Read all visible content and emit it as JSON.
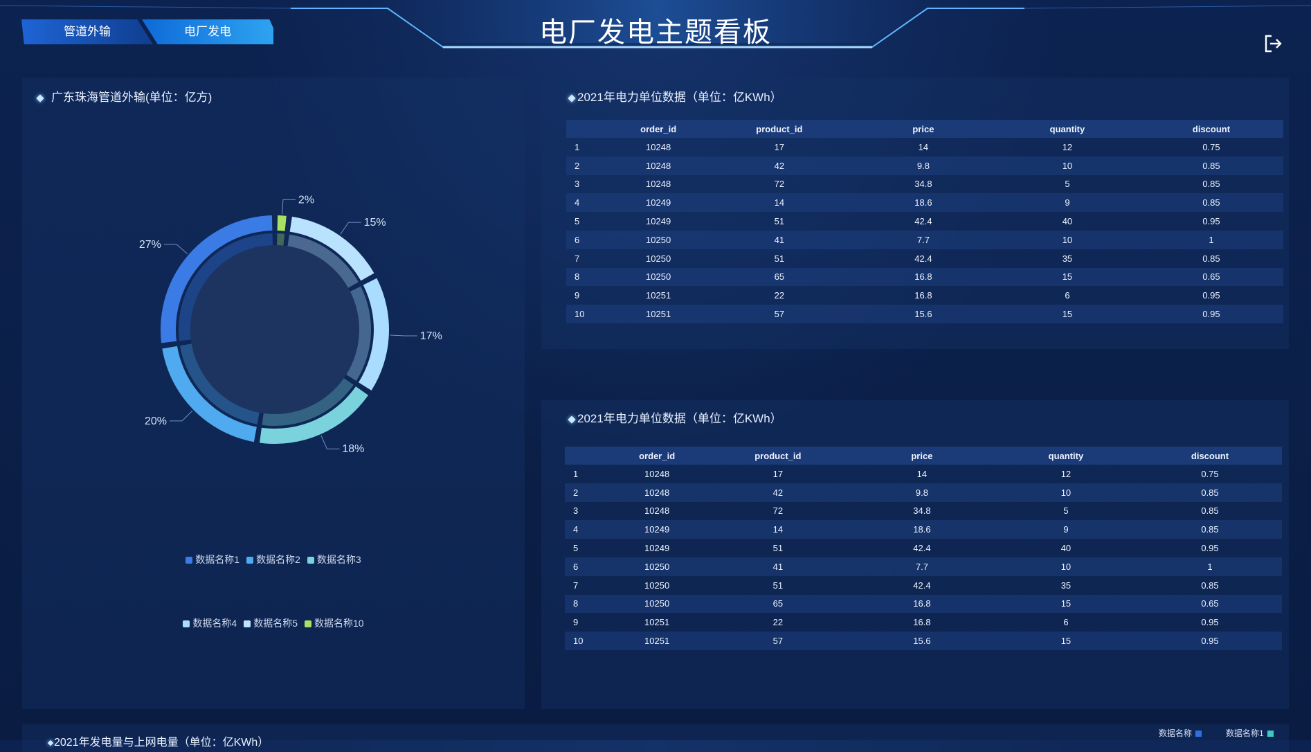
{
  "header": {
    "title": "电厂发电主题看板",
    "tabs": [
      {
        "label": "管道外输",
        "active": false
      },
      {
        "label": "电厂发电",
        "active": true
      }
    ],
    "logout_icon": "logout-icon"
  },
  "left_panel": {
    "title": "广东珠海管道外输(单位：亿方)",
    "legend_row1": [
      {
        "label": "数据名称1",
        "color": "#3a7be6"
      },
      {
        "label": "数据名称2",
        "color": "#4faaf0"
      },
      {
        "label": "数据名称3",
        "color": "#79d2dc"
      }
    ],
    "legend_row2": [
      {
        "label": "数据名称4",
        "color": "#a9dcff"
      },
      {
        "label": "数据名称5",
        "color": "#bfe3ff"
      },
      {
        "label": "数据名称10",
        "color": "#a8e063"
      }
    ]
  },
  "chart_data": {
    "type": "pie",
    "title": "广东珠海管道外输(单位：亿方)",
    "labels": [
      "数据名称10",
      "数据名称5",
      "数据名称4",
      "数据名称3",
      "数据名称2",
      "数据名称1"
    ],
    "values": [
      2,
      15,
      17,
      18,
      20,
      27
    ],
    "value_labels": [
      "2%",
      "15%",
      "17%",
      "18%",
      "20%",
      "27%"
    ],
    "colors": [
      "#a8e063",
      "#b9e2ff",
      "#a9dcff",
      "#79d2dc",
      "#4faaf0",
      "#3a7be6"
    ],
    "style": "donut"
  },
  "table1": {
    "title": "2021年电力单位数据（单位：亿KWh）",
    "columns": [
      "",
      "order_id",
      "product_id",
      "price",
      "quantity",
      "discount"
    ],
    "rows": [
      [
        "1",
        "10248",
        "17",
        "14",
        "12",
        "0.75"
      ],
      [
        "2",
        "10248",
        "42",
        "9.8",
        "10",
        "0.85"
      ],
      [
        "3",
        "10248",
        "72",
        "34.8",
        "5",
        "0.85"
      ],
      [
        "4",
        "10249",
        "14",
        "18.6",
        "9",
        "0.85"
      ],
      [
        "5",
        "10249",
        "51",
        "42.4",
        "40",
        "0.95"
      ],
      [
        "6",
        "10250",
        "41",
        "7.7",
        "10",
        "1"
      ],
      [
        "7",
        "10250",
        "51",
        "42.4",
        "35",
        "0.85"
      ],
      [
        "8",
        "10250",
        "65",
        "16.8",
        "15",
        "0.65"
      ],
      [
        "9",
        "10251",
        "22",
        "16.8",
        "6",
        "0.95"
      ],
      [
        "10",
        "10251",
        "57",
        "15.6",
        "15",
        "0.95"
      ]
    ]
  },
  "table2": {
    "title": "2021年电力单位数据（单位：亿KWh）",
    "columns": [
      "",
      "order_id",
      "product_id",
      "price",
      "quantity",
      "discount"
    ],
    "rows": [
      [
        "1",
        "10248",
        "17",
        "14",
        "12",
        "0.75"
      ],
      [
        "2",
        "10248",
        "42",
        "9.8",
        "10",
        "0.85"
      ],
      [
        "3",
        "10248",
        "72",
        "34.8",
        "5",
        "0.85"
      ],
      [
        "4",
        "10249",
        "14",
        "18.6",
        "9",
        "0.85"
      ],
      [
        "5",
        "10249",
        "51",
        "42.4",
        "40",
        "0.95"
      ],
      [
        "6",
        "10250",
        "41",
        "7.7",
        "10",
        "1"
      ],
      [
        "7",
        "10250",
        "51",
        "42.4",
        "35",
        "0.85"
      ],
      [
        "8",
        "10250",
        "65",
        "16.8",
        "15",
        "0.65"
      ],
      [
        "9",
        "10251",
        "22",
        "16.8",
        "6",
        "0.95"
      ],
      [
        "10",
        "10251",
        "57",
        "15.6",
        "15",
        "0.95"
      ]
    ]
  },
  "bottom_panel": {
    "title": "2021年发电量与上网电量（单位：亿KWh）",
    "legend": [
      {
        "label": "数据名称",
        "color": "#2f6fe0"
      },
      {
        "label": "数据名称1",
        "color": "#3fc7c2"
      }
    ]
  }
}
